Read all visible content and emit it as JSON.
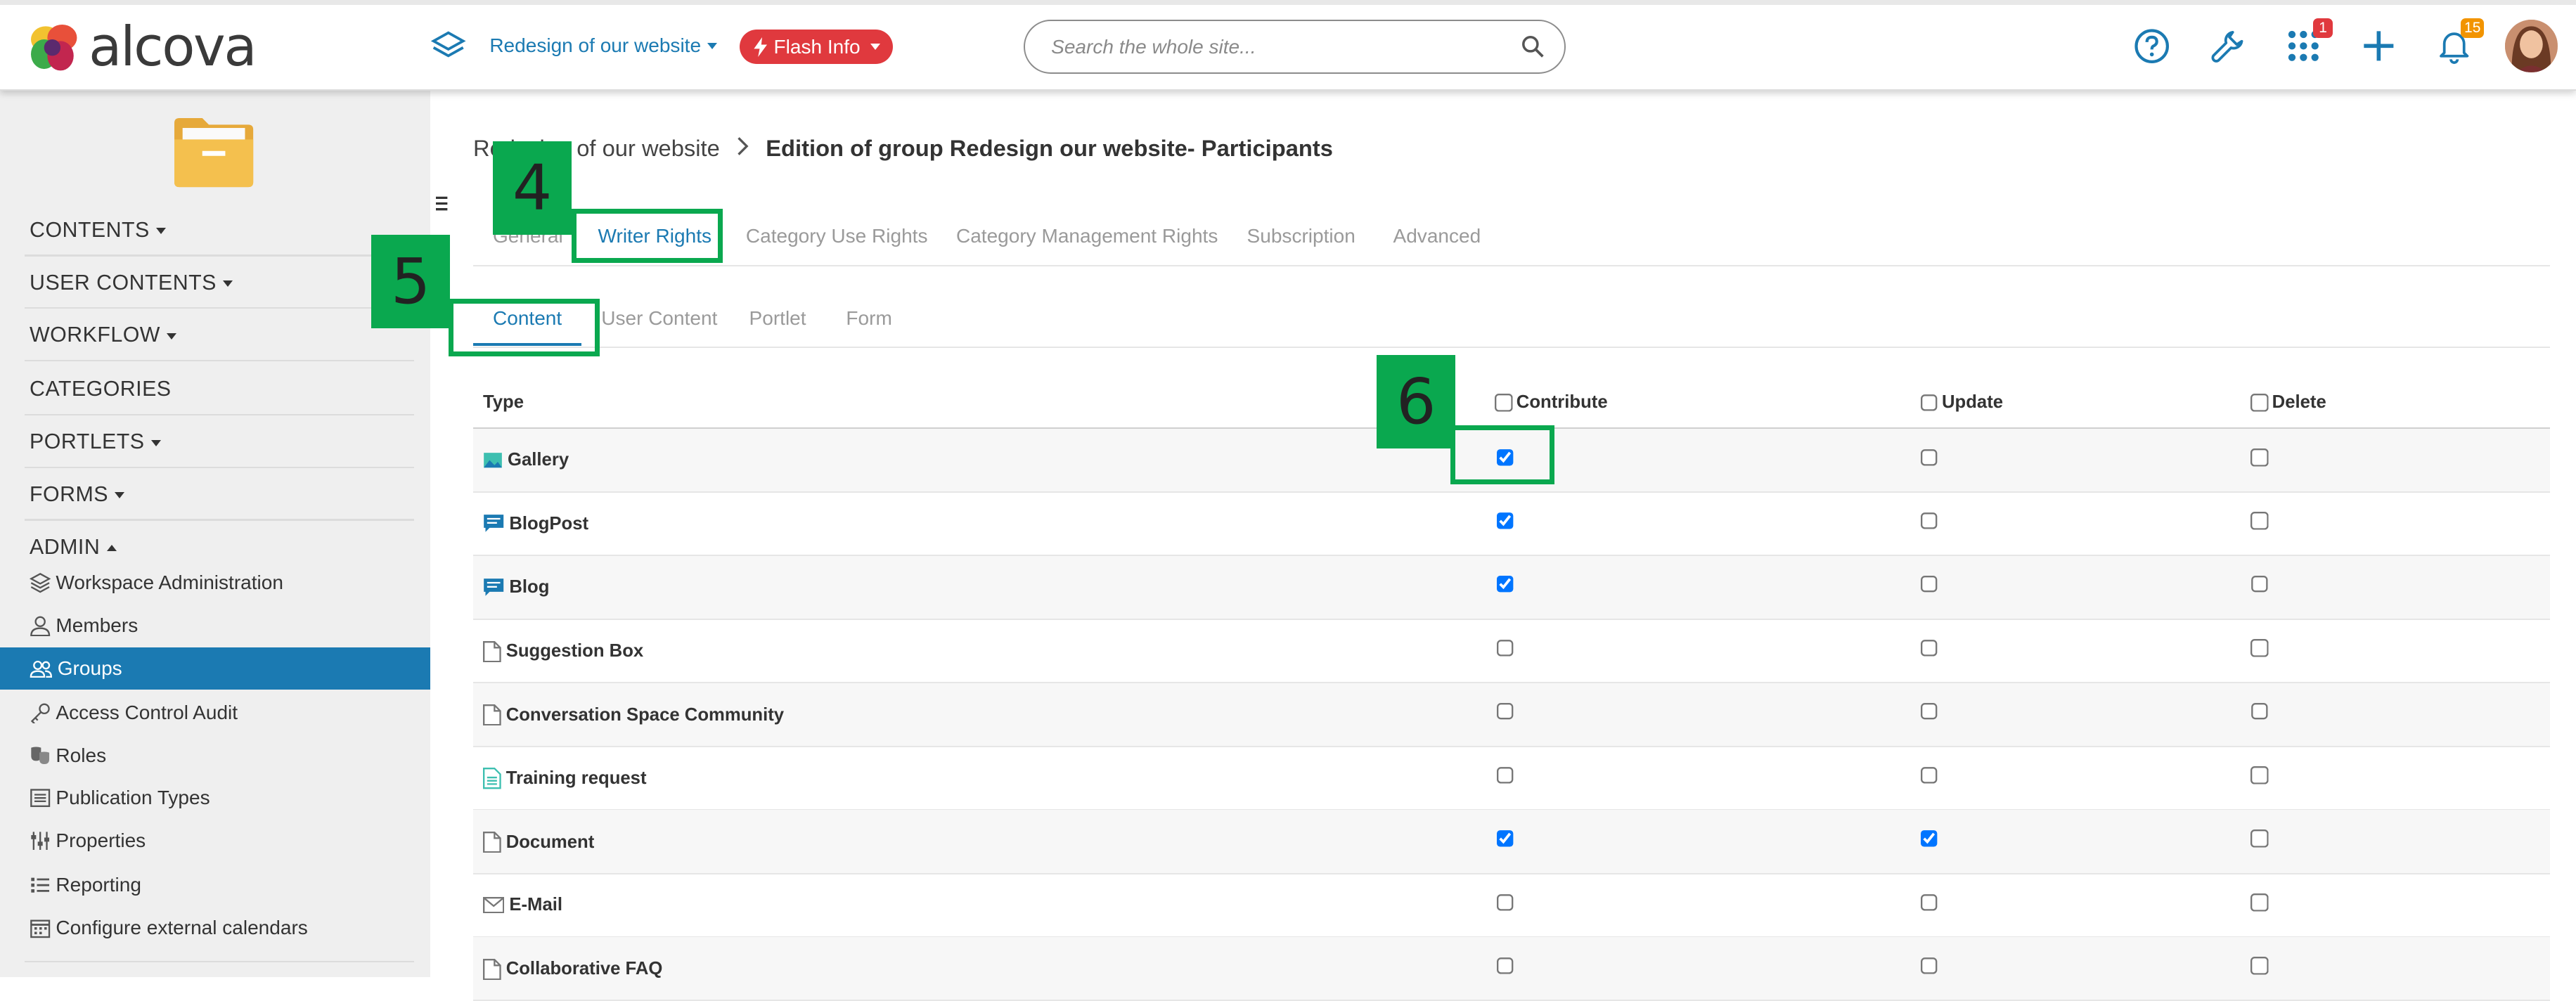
{
  "header": {
    "logo_text": "alcova",
    "workspace_label": "Redesign of our website",
    "flash_label": "Flash Info",
    "search_placeholder": "Search the whole site...",
    "apps_badge": "1",
    "notifications_badge": "15",
    "accent": "#1b7ab2",
    "flash_color": "#e0393e"
  },
  "sidebar": {
    "menu": [
      "CONTENTS",
      "USER CONTENTS",
      "WORKFLOW",
      "CATEGORIES",
      "PORTLETS",
      "FORMS",
      "ADMIN"
    ],
    "admin_items": [
      {
        "label": "Workspace Administration",
        "icon": "layers-icon"
      },
      {
        "label": "Members",
        "icon": "user-icon"
      },
      {
        "label": "Groups",
        "icon": "users-icon"
      },
      {
        "label": "Access Control Audit",
        "icon": "key-icon"
      },
      {
        "label": "Roles",
        "icon": "masks-icon"
      },
      {
        "label": "Publication Types",
        "icon": "list-icon"
      },
      {
        "label": "Properties",
        "icon": "sliders-icon"
      },
      {
        "label": "Reporting",
        "icon": "bullet-list-icon"
      },
      {
        "label": "Configure external calendars",
        "icon": "calendar-icon"
      }
    ],
    "active_item": "Groups"
  },
  "breadcrumb": {
    "workspace": "Redesign of our website",
    "current": "Edition of group Redesign our website- Participants"
  },
  "tabs": [
    "General",
    "Writer Rights",
    "Category Use Rights",
    "Category Management Rights",
    "Subscription",
    "Advanced"
  ],
  "active_tab": "Writer Rights",
  "subtabs": [
    "Content",
    "User Content",
    "Portlet",
    "Form"
  ],
  "active_subtab": "Content",
  "table": {
    "headers": {
      "type": "Type",
      "contribute": "Contribute",
      "update": "Update",
      "delete": "Delete"
    },
    "rows": [
      {
        "type": "Gallery",
        "icon": "gallery-icon",
        "contribute": true,
        "update": false,
        "delete": false
      },
      {
        "type": "BlogPost",
        "icon": "blogpost-icon",
        "contribute": true,
        "update": false,
        "delete": false
      },
      {
        "type": "Blog",
        "icon": "blog-icon",
        "contribute": true,
        "update": false,
        "delete": false
      },
      {
        "type": "Suggestion Box",
        "icon": "document-icon",
        "contribute": false,
        "update": false,
        "delete": false
      },
      {
        "type": "Conversation Space Community",
        "icon": "document-icon",
        "contribute": false,
        "update": false,
        "delete": false
      },
      {
        "type": "Training request",
        "icon": "form-document-icon",
        "contribute": false,
        "update": false,
        "delete": false
      },
      {
        "type": "Document",
        "icon": "document-icon",
        "contribute": true,
        "update": true,
        "delete": false
      },
      {
        "type": "E-Mail",
        "icon": "mail-icon",
        "contribute": false,
        "update": false,
        "delete": false
      },
      {
        "type": "Collaborative FAQ",
        "icon": "document-icon",
        "contribute": false,
        "update": false,
        "delete": false
      }
    ]
  },
  "annotations": {
    "step_tabs": "4",
    "step_subtabs": "5",
    "step_checkbox": "6",
    "color": "#0aa84f"
  }
}
